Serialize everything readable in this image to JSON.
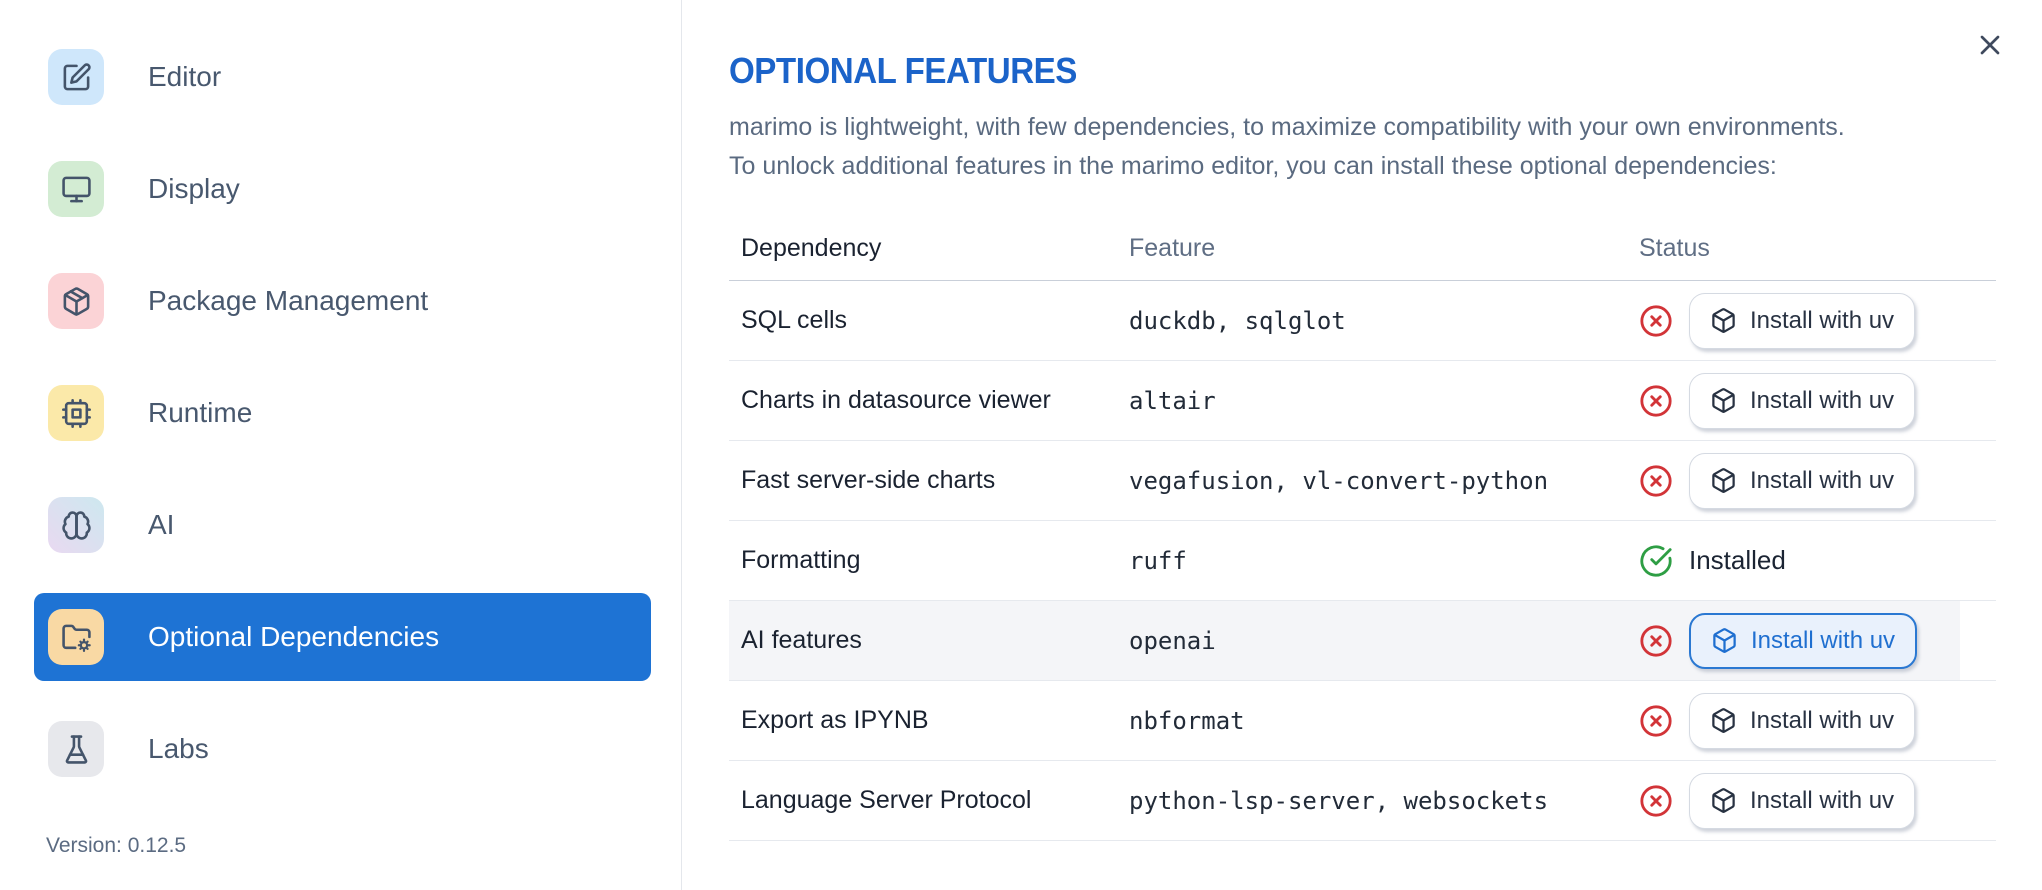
{
  "sidebar": {
    "items": [
      {
        "label": "Editor",
        "slug": "editor",
        "icon": "edit-icon",
        "tile_color": "#cfe7fb",
        "selected": false
      },
      {
        "label": "Display",
        "slug": "display",
        "icon": "monitor-icon",
        "tile_color": "#d3ecd3",
        "selected": false
      },
      {
        "label": "Package Management",
        "slug": "package-management",
        "icon": "package-icon",
        "tile_color": "#fbd3d6",
        "selected": false
      },
      {
        "label": "Runtime",
        "slug": "runtime",
        "icon": "cpu-icon",
        "tile_color": "#fbe9a9",
        "selected": false
      },
      {
        "label": "AI",
        "slug": "ai",
        "icon": "brain-icon",
        "tile_gradient": [
          "#cde8ef",
          "#e9d9f1"
        ],
        "selected": false
      },
      {
        "label": "Optional Dependencies",
        "slug": "optional-dependencies",
        "icon": "folder-cog-icon",
        "tile_color": "#f9d9a4",
        "selected": true
      },
      {
        "label": "Labs",
        "slug": "labs",
        "icon": "flask-icon",
        "tile_color": "#e7e8ec",
        "selected": false
      }
    ],
    "version": "Version: 0.12.5"
  },
  "main": {
    "title": "OPTIONAL FEATURES",
    "description_line1": "marimo is lightweight, with few dependencies, to maximize compatibility with your own environments.",
    "description_line2": "To unlock additional features in the marimo editor, you can install these optional dependencies:",
    "close_icon": "close-icon",
    "table": {
      "columns": [
        "Dependency",
        "Feature",
        "Status"
      ],
      "rows": [
        {
          "dependency": "SQL cells",
          "feature": "duckdb, sqlglot",
          "status": "missing",
          "status_icon": "circle-x-icon",
          "action": "Install with uv",
          "highlighted": false
        },
        {
          "dependency": "Charts in datasource viewer",
          "feature": "altair",
          "status": "missing",
          "status_icon": "circle-x-icon",
          "action": "Install with uv",
          "highlighted": false
        },
        {
          "dependency": "Fast server-side charts",
          "feature": "vegafusion, vl-convert-python",
          "status": "missing",
          "status_icon": "circle-x-icon",
          "action": "Install with uv",
          "highlighted": false
        },
        {
          "dependency": "Formatting",
          "feature": "ruff",
          "status": "installed",
          "status_icon": "circle-check-icon",
          "status_label": "Installed",
          "highlighted": false
        },
        {
          "dependency": "AI features",
          "feature": "openai",
          "status": "missing",
          "status_icon": "circle-x-icon",
          "action": "Install with uv",
          "highlighted": true
        },
        {
          "dependency": "Export as IPYNB",
          "feature": "nbformat",
          "status": "missing",
          "status_icon": "circle-x-icon",
          "action": "Install with uv",
          "highlighted": false
        },
        {
          "dependency": "Language Server Protocol",
          "feature": "python-lsp-server, websockets",
          "status": "missing",
          "status_icon": "circle-x-icon",
          "action": "Install with uv",
          "highlighted": false
        }
      ],
      "button_icon": "package-box-icon"
    },
    "colors": {
      "accent_blue": "#1e73d4",
      "title_blue": "#1b63c9",
      "error_red": "#d23438",
      "success_green": "#2e9e44",
      "highlight_row": "#f4f5f8"
    }
  }
}
